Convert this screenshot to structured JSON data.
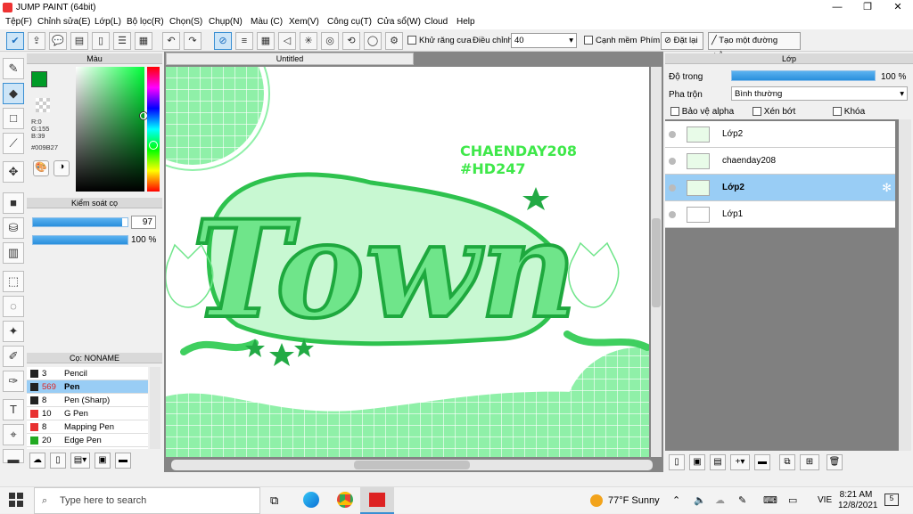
{
  "app": {
    "title": "JUMP PAINT (64bit)"
  },
  "menu": [
    "Tệp(F)",
    "Chỉnh sửa(E)",
    "Lớp(L)",
    "Bộ lọc(R)",
    "Chọn(S)",
    "Chụp(N)",
    "Màu (C)",
    "Xem(V)",
    "Công cụ(T)",
    "Cửa sổ(W)",
    "Cloud",
    "Help"
  ],
  "toolbar": {
    "antialias_label": "Khử răng cưa",
    "adjust_label": "Điều chỉnh",
    "adjust_value": "40",
    "sharp_edge_label": "Cạnh mềm",
    "key_label": "Phím",
    "reset_label": "Đặt lại",
    "straight_label": "Tạo một đường thẳng"
  },
  "color_panel": {
    "title": "Màu",
    "r": "R:0",
    "g": "G:155",
    "b": "B:39",
    "hex": "#009B27",
    "main_color": "#009B27"
  },
  "brush_control": {
    "title": "Kiểm soát cọ",
    "size": "97",
    "opacity": "100 %"
  },
  "brush_list": {
    "title": "Cọ: NONAME",
    "items": [
      {
        "size": "3",
        "name": "Pencil",
        "color": "#222222"
      },
      {
        "size": "569",
        "name": "Pen",
        "color": "#222222"
      },
      {
        "size": "8",
        "name": "Pen (Sharp)",
        "color": "#222222"
      },
      {
        "size": "10",
        "name": "G Pen",
        "color": "#e83030"
      },
      {
        "size": "8",
        "name": "Mapping Pen",
        "color": "#e83030"
      },
      {
        "size": "20",
        "name": "Edge Pen",
        "color": "#22aa22"
      }
    ]
  },
  "canvas": {
    "tab": "Untitled",
    "art_text": "Town",
    "credit_line1": "CHAENDAY208",
    "credit_line2": "#HD247"
  },
  "layers_panel": {
    "title": "Lớp",
    "opacity_label": "Độ trong",
    "opacity_value": "100 %",
    "blend_label": "Pha trộn",
    "blend_value": "Bình thường",
    "protect_alpha": "Bảo vệ alpha",
    "clipping": "Xén bớt",
    "lock": "Khóa",
    "layers": [
      {
        "name": "Lớp2"
      },
      {
        "name": "chaenday208"
      },
      {
        "name": "Lớp2"
      },
      {
        "name": "Lớp1"
      }
    ]
  },
  "taskbar": {
    "search_placeholder": "Type here to search",
    "weather": "77°F  Sunny",
    "lang": "VIE",
    "time": "8:21 AM",
    "date": "12/8/2021",
    "notif": "5"
  }
}
